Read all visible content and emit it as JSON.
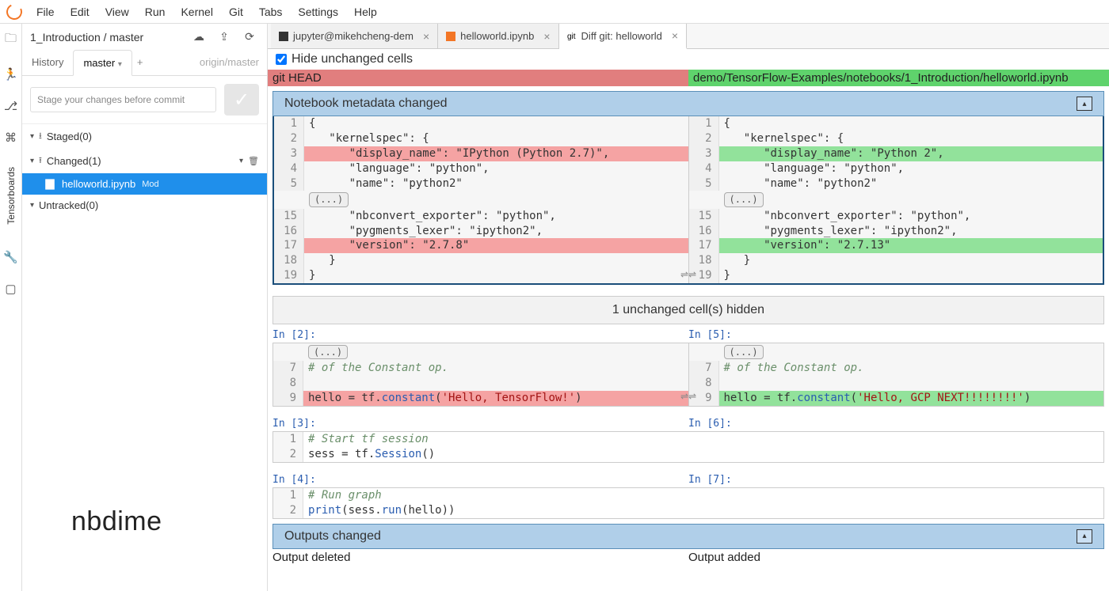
{
  "menu": [
    "File",
    "Edit",
    "View",
    "Run",
    "Kernel",
    "Git",
    "Tabs",
    "Settings",
    "Help"
  ],
  "activity": {
    "vlabel": "Tensorboards"
  },
  "sidebar": {
    "breadcrumb": "1_Introduction / master",
    "tabs": {
      "history": "History",
      "current": "master",
      "remote": "origin/master"
    },
    "commit_placeholder": "Stage your changes before commit",
    "sections": {
      "staged": "Staged(0)",
      "changed": "Changed(1)",
      "untracked": "Untracked(0)"
    },
    "file": {
      "name": "helloworld.ipynb",
      "badge": "Mod"
    }
  },
  "tabs": [
    {
      "icon": "terminal",
      "label": "jupyter@mikehcheng-dem"
    },
    {
      "icon": "notebook",
      "label": "helloworld.ipynb"
    },
    {
      "icon": "git",
      "label": "Diff git: helloworld"
    }
  ],
  "hide_label": "Hide unchanged cells",
  "diff_header": {
    "left": "git HEAD",
    "right": "demo/TensorFlow-Examples/notebooks/1_Introduction/helloworld.ipynb"
  },
  "metadata_panel": {
    "title": "Notebook metadata changed",
    "left": [
      {
        "n": 1,
        "t": "{"
      },
      {
        "n": 2,
        "t": "   \"kernelspec\": {"
      },
      {
        "n": 3,
        "t": "      \"display_name\": \"IPython (Python 2.7)\",",
        "cls": "hl-del"
      },
      {
        "n": 4,
        "t": "      \"language\": \"python\","
      },
      {
        "n": 5,
        "t": "      \"name\": \"python2\""
      },
      {
        "fold": "(...)"
      },
      {
        "n": 15,
        "t": "      \"nbconvert_exporter\": \"python\","
      },
      {
        "n": 16,
        "t": "      \"pygments_lexer\": \"ipython2\","
      },
      {
        "n": 17,
        "t": "      \"version\": \"2.7.8\"",
        "cls": "hl-del"
      },
      {
        "n": 18,
        "t": "   }"
      },
      {
        "n": 19,
        "t": "}"
      }
    ],
    "right": [
      {
        "n": 1,
        "t": "{"
      },
      {
        "n": 2,
        "t": "   \"kernelspec\": {"
      },
      {
        "n": 3,
        "t": "      \"display_name\": \"Python 2\",",
        "cls": "hl-add"
      },
      {
        "n": 4,
        "t": "      \"language\": \"python\","
      },
      {
        "n": 5,
        "t": "      \"name\": \"python2\""
      },
      {
        "fold": "(...)"
      },
      {
        "n": 15,
        "t": "      \"nbconvert_exporter\": \"python\","
      },
      {
        "n": 16,
        "t": "      \"pygments_lexer\": \"ipython2\","
      },
      {
        "n": 17,
        "t": "      \"version\": \"2.7.13\"",
        "cls": "hl-add"
      },
      {
        "n": 18,
        "t": "   }"
      },
      {
        "n": 19,
        "t": "}"
      }
    ]
  },
  "hidden_bar": "1 unchanged cell(s) hidden",
  "cell2": {
    "left_prompt": "In [2]:",
    "right_prompt": "In [5]:",
    "left": [
      {
        "fold": "(...)"
      },
      {
        "n": 7,
        "html": "<span class='k-com'># of the Constant op.</span>"
      },
      {
        "n": 8,
        "html": ""
      },
      {
        "n": 9,
        "html": "hello = tf.<span class='k-fn'>constant</span>(<span class='k-str'>'Hello, TensorFlow!'</span>)",
        "cls": "hl-del"
      }
    ],
    "right": [
      {
        "fold": "(...)"
      },
      {
        "n": 7,
        "html": "<span class='k-com'># of the Constant op.</span>"
      },
      {
        "n": 8,
        "html": ""
      },
      {
        "n": 9,
        "html": "hello = tf.<span class='k-fn'>constant</span>(<span class='k-str'>'Hello, GCP NEXT!!!!!!!!'</span>)",
        "cls": "hl-add"
      }
    ]
  },
  "cell3": {
    "left_prompt": "In [3]:",
    "right_prompt": "In [6]:",
    "lines": [
      {
        "n": 1,
        "html": "<span class='k-com'># Start tf session</span>"
      },
      {
        "n": 2,
        "html": "sess = tf.<span class='k-fn'>Session</span>()"
      }
    ]
  },
  "cell4": {
    "left_prompt": "In [4]:",
    "right_prompt": "In [7]:",
    "lines": [
      {
        "n": 1,
        "html": "<span class='k-com'># Run graph</span>"
      },
      {
        "n": 2,
        "html": "<span class='k-fn'>print</span>(sess.<span class='k-fn'>run</span>(hello))"
      }
    ]
  },
  "outputs_panel": {
    "title": "Outputs changed",
    "left": "Output deleted",
    "right": "Output added"
  },
  "brand": "nbdime"
}
